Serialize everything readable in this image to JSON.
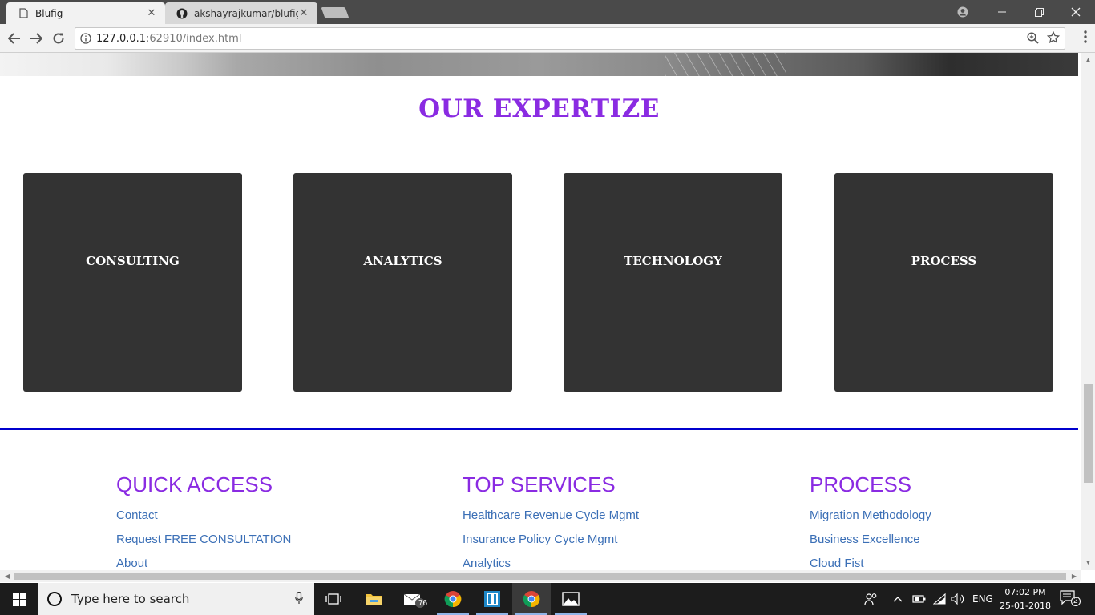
{
  "browser": {
    "tabs": [
      {
        "title": "Blufig",
        "icon": "page-icon",
        "close": "✕"
      },
      {
        "title": "akshayrajkumar/blufig",
        "icon": "github-icon",
        "close": "✕"
      }
    ],
    "url_host": "127.0.0.1",
    "url_path": ":62910/index.html"
  },
  "expertise": {
    "title": "OUR EXPERTIZE",
    "cards": [
      "CONSULTING",
      "ANALYTICS",
      "TECHNOLOGY",
      "PROCESS"
    ],
    "card_color": "#333333",
    "title_color": "#8a2be2"
  },
  "divider_color": "#0000cd",
  "footer": {
    "quick_access": {
      "title": "QUICK ACCESS",
      "links": [
        "Contact",
        "Request FREE CONSULTATION",
        "About"
      ]
    },
    "top_services": {
      "title": "TOP SERVICES",
      "links": [
        "Healthcare Revenue Cycle Mgmt",
        "Insurance Policy Cycle Mgmt",
        "Analytics"
      ]
    },
    "process": {
      "title": "PROCESS",
      "links": [
        "Migration Methodology",
        "Business Excellence",
        "Cloud Fist"
      ]
    },
    "link_color": "#3b6fb6"
  },
  "taskbar": {
    "search_placeholder": "Type here to search",
    "mail_badge": "76",
    "language": "ENG",
    "time": "07:02 PM",
    "date": "25-01-2018",
    "notification_count": "2"
  }
}
